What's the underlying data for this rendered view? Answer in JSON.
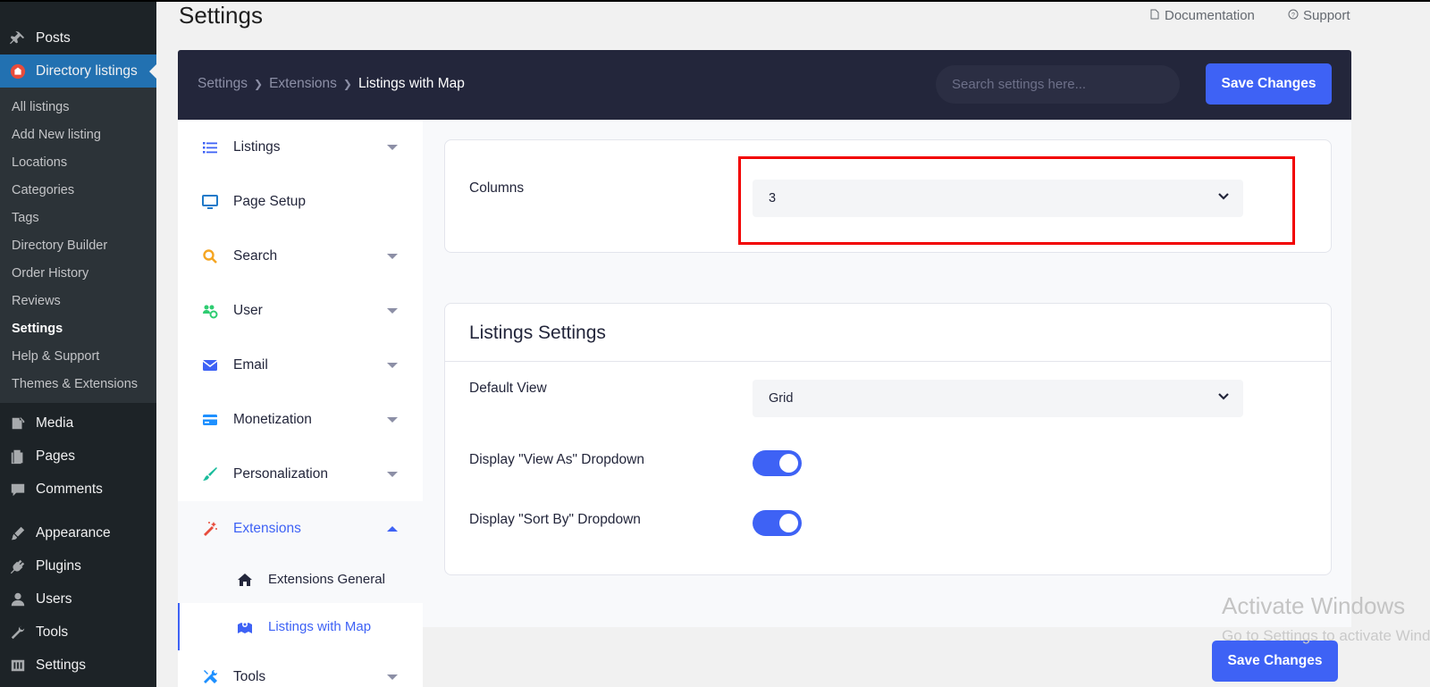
{
  "wp_menu": {
    "top_items": [
      {
        "label": "Posts",
        "icon": "pin-icon"
      },
      {
        "label": "Directory listings",
        "icon": "directory-icon"
      }
    ],
    "submenu": [
      "All listings",
      "Add New listing",
      "Locations",
      "Categories",
      "Tags",
      "Directory Builder",
      "Order History",
      "Reviews",
      "Settings",
      "Help & Support",
      "Themes & Extensions"
    ],
    "current_submenu": "Settings",
    "bottom_items": [
      {
        "label": "Media",
        "icon": "media-icon"
      },
      {
        "label": "Pages",
        "icon": "pages-icon"
      },
      {
        "label": "Comments",
        "icon": "comments-icon"
      },
      {
        "label": "Appearance",
        "icon": "appearance-icon"
      },
      {
        "label": "Plugins",
        "icon": "plugins-icon"
      },
      {
        "label": "Users",
        "icon": "users-icon"
      },
      {
        "label": "Tools",
        "icon": "tools-icon"
      },
      {
        "label": "Settings",
        "icon": "settings-icon"
      }
    ]
  },
  "page": {
    "title": "Settings",
    "documentation_label": "Documentation",
    "support_label": "Support"
  },
  "header": {
    "breadcrumb": [
      "Settings",
      "Extensions",
      "Listings with Map"
    ],
    "search_placeholder": "Search settings here...",
    "save_label": "Save Changes"
  },
  "settings_nav": {
    "items": [
      {
        "label": "Listings",
        "icon": "list-icon",
        "color": "#3e62f5"
      },
      {
        "label": "Page Setup",
        "icon": "monitor-icon",
        "color": "#1e7ac9"
      },
      {
        "label": "Search",
        "icon": "search-icon",
        "color": "#f5a623"
      },
      {
        "label": "User",
        "icon": "users-gear-icon",
        "color": "#2ecc71"
      },
      {
        "label": "Email",
        "icon": "envelope-icon",
        "color": "#3e62f5"
      },
      {
        "label": "Monetization",
        "icon": "credit-card-icon",
        "color": "#1e90ff"
      },
      {
        "label": "Personalization",
        "icon": "brush-icon",
        "color": "#1abc9c"
      },
      {
        "label": "Extensions",
        "icon": "magic-wand-icon",
        "color": "#e74c3c"
      }
    ],
    "extensions_sub": [
      {
        "label": "Extensions General",
        "icon": "home-icon"
      },
      {
        "label": "Listings with Map",
        "icon": "map-marker-icon"
      }
    ],
    "tools": {
      "label": "Tools",
      "icon": "tools-cross-icon"
    }
  },
  "columns_card": {
    "label": "Columns",
    "value": "3"
  },
  "listings_card": {
    "title": "Listings Settings",
    "default_view_label": "Default View",
    "default_view_value": "Grid",
    "view_as_label": "Display \"View As\" Dropdown",
    "view_as_on": true,
    "sort_by_label": "Display \"Sort By\" Dropdown",
    "sort_by_on": true
  },
  "footer": {
    "save_label": "Save Changes"
  },
  "watermark": {
    "line1": "Activate Windows",
    "line2": "Go to Settings to activate Windows."
  },
  "colors": {
    "accent": "#3e62f5",
    "header_bg": "#23263b",
    "highlight": "#f20000"
  }
}
